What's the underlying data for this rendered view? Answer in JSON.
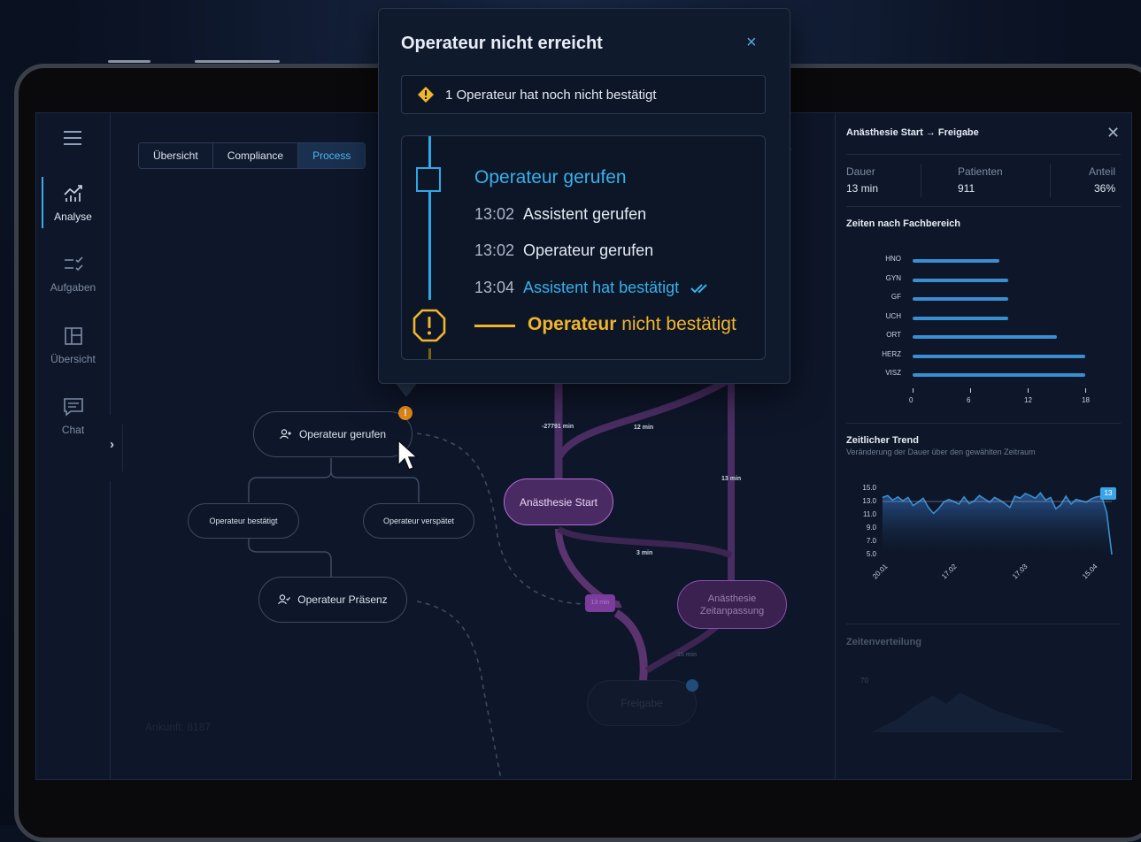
{
  "colors": {
    "accent_blue": "#36b0ec",
    "warning_yellow": "#f1b52c",
    "alert_orange": "#e88a1a",
    "process_purple": "#b06cd6",
    "background": "#0e1629"
  },
  "sidebar": {
    "items": [
      {
        "label": "Analyse",
        "icon": "chart-icon",
        "active": true
      },
      {
        "label": "Aufgaben",
        "icon": "checklist-icon",
        "active": false
      },
      {
        "label": "Übersicht",
        "icon": "layout-icon",
        "active": false
      },
      {
        "label": "Chat",
        "icon": "chat-icon",
        "active": false
      }
    ]
  },
  "tabs": [
    {
      "label": "Übersicht",
      "selected": false
    },
    {
      "label": "Compliance",
      "selected": false
    },
    {
      "label": "Process",
      "selected": true
    }
  ],
  "graph": {
    "nodes": {
      "operateur_gerufen": "Operateur gerufen",
      "operateur_bestaetigt": "Operateur bestätigt",
      "operateur_verspaetet": "Operateur verspätet",
      "operateur_praesenz": "Operateur Präsenz",
      "anaesthesie_start": "Anästhesie Start",
      "anaesthesie_zeitanpassung": "Anästhesie Zeitanpassung",
      "freigabe": "Freigabe"
    },
    "warning_badge": "!",
    "edges": {
      "e1": "-27791 min",
      "e2": "12 min",
      "e3": "13 min",
      "e4": "3 min",
      "e5": "13 min",
      "e6": "15 min"
    },
    "faint_label": "Ankunft: 8187"
  },
  "right_panel": {
    "title": "Anästhesie Start → Freigabe",
    "stats": [
      {
        "label": "Dauer",
        "value": "13 min"
      },
      {
        "label": "Patienten",
        "value": "911"
      },
      {
        "label": "Anteil",
        "value": "36%"
      }
    ],
    "fachbereich": {
      "title": "Zeiten nach Fachbereich",
      "ticks": [
        "0",
        "6",
        "12",
        "18"
      ]
    },
    "trend": {
      "title": "Zeitlicher Trend",
      "subtitle": "Veränderung der Dauer über den gewählten Zeitraum",
      "y_ticks": [
        "15.0",
        "13.0",
        "11.0",
        "9.0",
        "7.0",
        "5.0"
      ],
      "x_ticks": [
        "20.01",
        "17.02",
        "17.03",
        "15.04"
      ],
      "badge": "13"
    },
    "verteilung": {
      "title": "Zeitenverteilung",
      "y_tick": "70"
    }
  },
  "popup": {
    "title": "Operateur nicht erreicht",
    "close": "×",
    "alert": "1 Operateur hat noch nicht bestätigt",
    "timeline_head": "Operateur gerufen",
    "events": [
      {
        "time": "13:02",
        "label": "Assistent gerufen"
      },
      {
        "time": "13:02",
        "label": "Operateur gerufen"
      },
      {
        "time": "13:04",
        "label": "Assistent hat bestätigt"
      }
    ],
    "failure_bold": "Operateur",
    "failure_rest": " nicht bestätigt"
  },
  "chart_data": [
    {
      "type": "bar",
      "orientation": "horizontal",
      "title": "Zeiten nach Fachbereich",
      "categories": [
        "HNO",
        "GYN",
        "GF",
        "UCH",
        "ORT",
        "HERZ",
        "VISZ"
      ],
      "values": [
        9,
        10,
        10,
        10,
        15,
        18,
        18
      ],
      "xlim": [
        0,
        18
      ],
      "x_ticks": [
        0,
        6,
        12,
        18
      ],
      "color": "#3a8fd0"
    },
    {
      "type": "area",
      "title": "Zeitlicher Trend",
      "subtitle": "Veränderung der Dauer über den gewählten Zeitraum",
      "x_ticks": [
        "20.01",
        "17.02",
        "17.03",
        "15.04"
      ],
      "ylim": [
        5.0,
        15.0
      ],
      "y_ticks": [
        15.0,
        13.0,
        11.0,
        9.0,
        7.0,
        5.0
      ],
      "reference_line": 13,
      "values": [
        13.6,
        13.9,
        13.2,
        13.7,
        13.1,
        13.6,
        12.4,
        12.9,
        13.5,
        12.1,
        11.2,
        11.9,
        12.9,
        13.3,
        13.0,
        12.6,
        13.7,
        12.7,
        13.1,
        13.9,
        13.4,
        12.9,
        13.6,
        13.2,
        12.7,
        12.1,
        13.8,
        13.5,
        14.2,
        13.9,
        13.5,
        14.3,
        13.2,
        13.6,
        11.9,
        12.5,
        13.8,
        12.6,
        13.3,
        13.1,
        12.9,
        13.4,
        13.7,
        13.8,
        11.4,
        5.0
      ],
      "color": "#3a8fd0"
    }
  ]
}
